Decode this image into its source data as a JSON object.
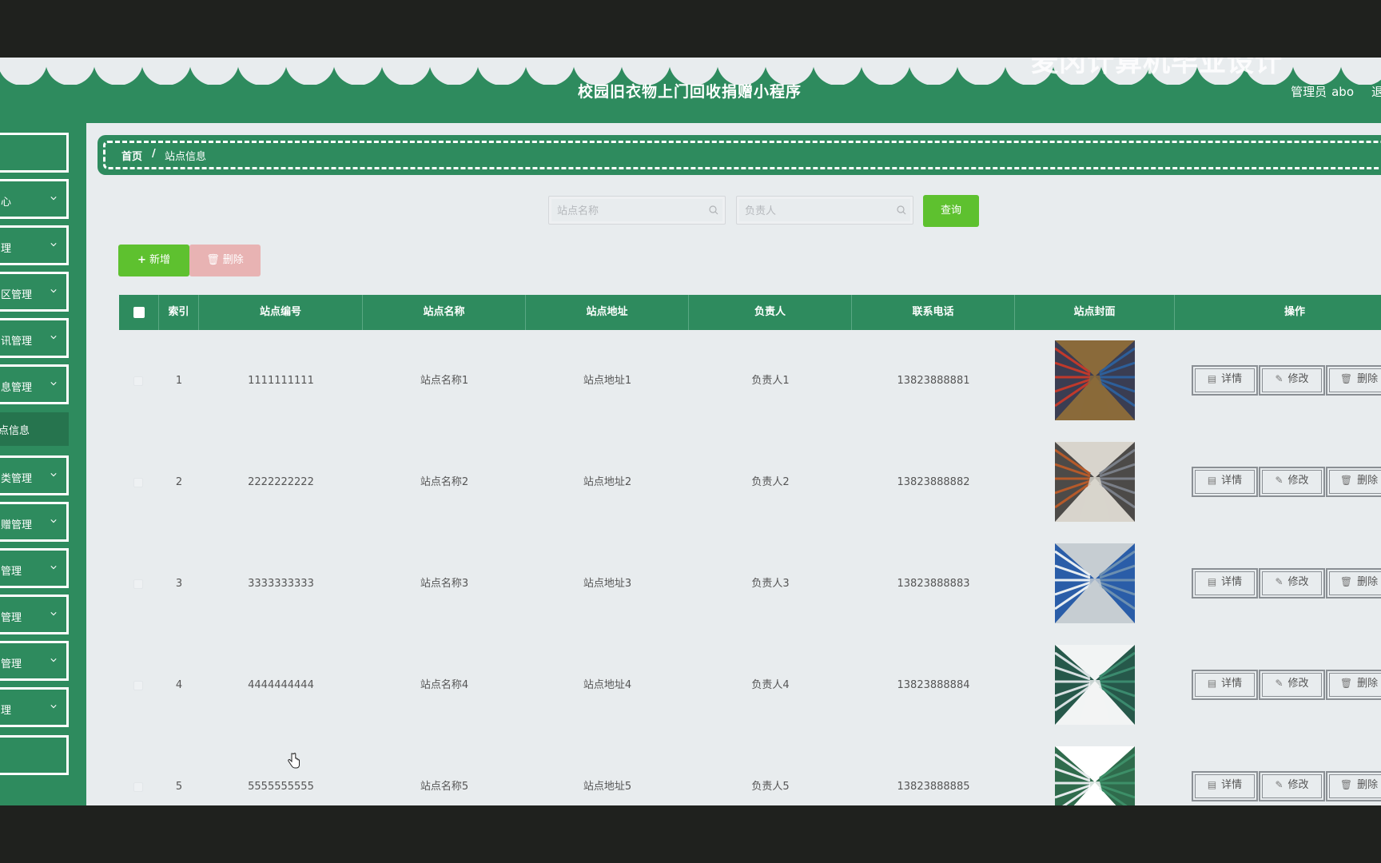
{
  "header": {
    "title": "校园旧衣物上门回收捐赠小程序",
    "admin_role": "管理员",
    "admin_name": "abo",
    "logout_label": "退出登录",
    "watermark": "麦冈计算机毕业设计"
  },
  "sidebar": {
    "items": [
      {
        "label": "",
        "expandable": false
      },
      {
        "label": "心",
        "expandable": true
      },
      {
        "label": "理",
        "expandable": true
      },
      {
        "label": "区管理",
        "expandable": true
      },
      {
        "label": "讯管理",
        "expandable": true
      },
      {
        "label": "息管理",
        "expandable": true
      },
      {
        "label": "点信息",
        "expandable": false,
        "active": true
      },
      {
        "label": "类管理",
        "expandable": true
      },
      {
        "label": "赠管理",
        "expandable": true
      },
      {
        "label": "管理",
        "expandable": true
      },
      {
        "label": "管理",
        "expandable": true
      },
      {
        "label": "管理",
        "expandable": true
      },
      {
        "label": "理",
        "expandable": true
      }
    ]
  },
  "breadcrumb": {
    "home": "首页",
    "separator": "/",
    "current": "站点信息"
  },
  "search": {
    "station_name_placeholder": "站点名称",
    "manager_placeholder": "负责人",
    "query_label": "查询"
  },
  "actions": {
    "add_label": "新增",
    "delete_label": "删除"
  },
  "table": {
    "columns": [
      "索引",
      "站点编号",
      "站点名称",
      "站点地址",
      "负责人",
      "联系电话",
      "站点封面",
      "操作"
    ],
    "rows": [
      {
        "index": "1",
        "code": "1111111111",
        "name": "站点名称1",
        "address": "站点地址1",
        "manager": "负责人1",
        "phone": "13823888881"
      },
      {
        "index": "2",
        "code": "2222222222",
        "name": "站点名称2",
        "address": "站点地址2",
        "manager": "负责人2",
        "phone": "13823888882"
      },
      {
        "index": "3",
        "code": "3333333333",
        "name": "站点名称3",
        "address": "站点地址3",
        "manager": "负责人3",
        "phone": "13823888883"
      },
      {
        "index": "4",
        "code": "4444444444",
        "name": "站点名称4",
        "address": "站点地址4",
        "manager": "负责人4",
        "phone": "13823888884"
      },
      {
        "index": "5",
        "code": "5555555555",
        "name": "站点名称5",
        "address": "站点地址5",
        "manager": "负责人5",
        "phone": "13823888885"
      }
    ],
    "row_actions": {
      "detail": "详情",
      "edit": "修改",
      "delete": "删除"
    }
  },
  "colors": {
    "primary": "#2e8b5e",
    "success": "#5ec12f",
    "danger_disabled": "#e8b3b3",
    "background": "#e8ecee"
  }
}
